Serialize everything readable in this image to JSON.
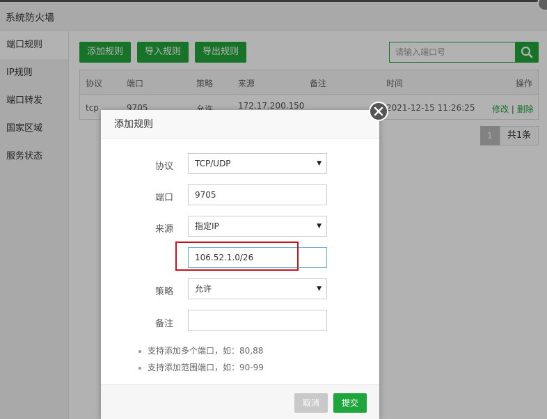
{
  "window": {
    "title": "系统防火墙"
  },
  "sidebar": {
    "items": [
      {
        "label": "端口规则",
        "active": true
      },
      {
        "label": "IP规则"
      },
      {
        "label": "端口转发"
      },
      {
        "label": "国家区域"
      },
      {
        "label": "服务状态"
      }
    ]
  },
  "toolbar": {
    "add_label": "添加规则",
    "import_label": "导入规则",
    "export_label": "导出规则",
    "search_placeholder": "请输入端口号",
    "search_icon": "search-icon"
  },
  "table": {
    "headers": [
      "协议",
      "端口",
      "策略",
      "来源",
      "备注",
      "时间",
      "操作"
    ],
    "rows": [
      {
        "protocol": "tcp",
        "port": "9705",
        "policy": "允许",
        "source": "172.17.200.150",
        "note": "",
        "time": "2021-12-15 11:26:25",
        "edit": "修改",
        "separator": "|",
        "delete": "删除"
      }
    ]
  },
  "pager": {
    "current": "1",
    "total": "共1条"
  },
  "dialog": {
    "title": "添加规则",
    "fields": {
      "protocol": {
        "label": "协议",
        "value": "TCP/UDP"
      },
      "port": {
        "label": "端口",
        "value": "9705"
      },
      "source": {
        "label": "来源",
        "value": "指定IP"
      },
      "source_ip": {
        "value": "106.52.1.0/26"
      },
      "policy": {
        "label": "策略",
        "value": "允许"
      },
      "note": {
        "label": "备注",
        "value": ""
      }
    },
    "tips": [
      "支持添加多个端口，如：80,88",
      "支持添加范围端口，如：90-99"
    ],
    "cancel_label": "取消",
    "submit_label": "提交"
  },
  "colors": {
    "accent": "#20a53a",
    "highlight_box": "#c8151d",
    "overlay": "rgba(0,0,0,0.3)"
  }
}
